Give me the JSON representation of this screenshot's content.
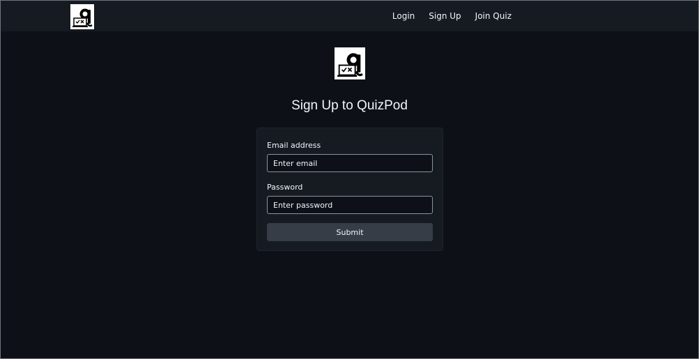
{
  "nav": {
    "logo_icon": "quizpod-logo-icon",
    "links": [
      "Login",
      "Sign Up",
      "Join Quiz"
    ]
  },
  "page": {
    "logo_icon": "quizpod-logo-icon",
    "title": "Sign Up to QuizPod"
  },
  "form": {
    "email_label": "Email address",
    "email_placeholder": "Enter email",
    "email_value": "",
    "password_label": "Password",
    "password_placeholder": "Enter password",
    "password_value": "",
    "submit_label": "Submit"
  },
  "colors": {
    "background": "#0d1117",
    "navbar": "#161b22",
    "card": "#161b22",
    "button": "#373d46",
    "text": "#f0f6fc"
  }
}
